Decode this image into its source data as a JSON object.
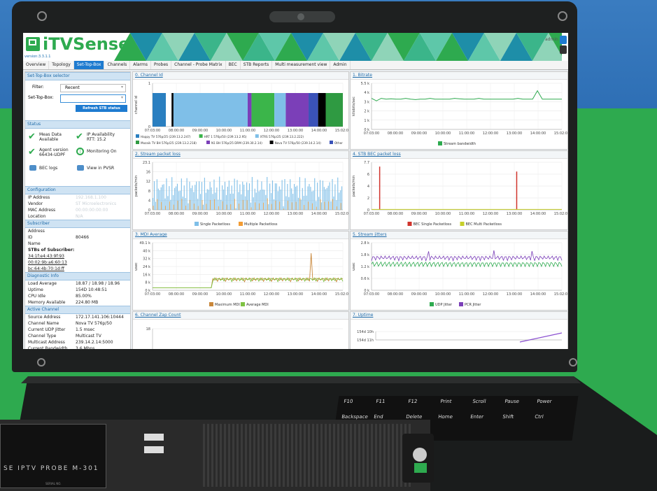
{
  "app": {
    "name": "iTVSense",
    "version": "version:3.3.1.1",
    "user": "admin"
  },
  "tabs": [
    "Overview",
    "Topology",
    "Set-Top-Box",
    "Channels",
    "Alarms",
    "Probes",
    "Channel - Probe Matrix",
    "BEC",
    "STB Reports",
    "Multi measurement view",
    "Admin"
  ],
  "active_tab": "Set-Top-Box",
  "sidebar": {
    "selector_title": "Set-Top-Box selector",
    "filter_label": "Filter:",
    "filter_value": "Recent",
    "stb_label": "Set-Top-Box:",
    "refresh_button": "Refresh STB status",
    "status_title": "Status",
    "status_items": {
      "meas_data": "Meas Data",
      "meas_data_2": "Available",
      "ip_avail": "IP Availability",
      "rtt": "RTT: 15.2",
      "agent": "Agent version",
      "agent_ver": "66434-UDPF",
      "monitoring": "Monitoring On",
      "bec_logs": "BEC logs",
      "view_pvsr": "View in PVSR"
    },
    "config_title": "Configuration",
    "config_rows": [
      {
        "k": "IP Address",
        "v": "192.168.1.100"
      },
      {
        "k": "Vendor",
        "v": "ST Microelectronics"
      },
      {
        "k": "MAC Address",
        "v": "00:00:00:00:00"
      },
      {
        "k": "Location",
        "v": "N/A"
      }
    ],
    "subscriber_title": "Subscriber",
    "subscriber_rows": [
      {
        "k": "Address",
        "v": ""
      },
      {
        "k": "ID",
        "v": "80466"
      },
      {
        "k": "Name",
        "v": ""
      }
    ],
    "stbs_title": "STBs of Subscriber:",
    "stbs": [
      "34:1f:e4:43:9f:93",
      "00:02:9b:a6:60:13",
      "bc:64:4b:70:1d:ff"
    ],
    "diag_title": "Diagnostic Info",
    "diag_rows": [
      {
        "k": "Load Average",
        "v": "18.87 / 18.98 / 18.96"
      },
      {
        "k": "Uptime",
        "v": "154D 10:48:51"
      },
      {
        "k": "CPU Idle",
        "v": "85.00%"
      },
      {
        "k": "Memory Available",
        "v": "224.80 MB"
      }
    ],
    "active_title": "Active Channel",
    "active_rows": [
      {
        "k": "Source Address",
        "v": "172.17.141.106:10444"
      },
      {
        "k": "Channel Name",
        "v": "Nova TV 576p/50"
      },
      {
        "k": "Current UDP Jitter",
        "v": "1.5 msec"
      },
      {
        "k": "Channel Type",
        "v": "Multicast TV"
      },
      {
        "k": "Multicast Address",
        "v": "239.14.2.14:5000"
      },
      {
        "k": "Current Bandwidth",
        "v": "3.6 Mbps"
      }
    ]
  },
  "panels": {
    "p0": "0. Channel Id",
    "p1": "1. Bitrate",
    "p2": "2. Stream packet loss",
    "p3": "3. MDI Average",
    "p4": "4. STB BEC packet loss",
    "p5": "5. Stream jitters",
    "p6": "6. Channel Zap Count",
    "p7": "7. Uptime"
  },
  "x_ticks": [
    "07:03:00",
    "08:00:00",
    "09:00:00",
    "10:00:00",
    "11:00:00",
    "12:00:00",
    "13:00:00",
    "14:00:00",
    "15:02:00"
  ],
  "chart_data": [
    {
      "type": "bar",
      "title": "0. Channel Id",
      "ylabel": "channel id",
      "y_ticks": [
        "0",
        "1"
      ],
      "segments": [
        {
          "series": "Happy TV 576p/25 (239.13.2.247)",
          "start": 0,
          "end": 0.07
        },
        {
          "series": "Nova TV 576p/50 (239.14.2.14)",
          "start": 0.1,
          "end": 0.11
        },
        {
          "series": "XTRS 576p/25 (239.13.2.222)",
          "start": 0.11,
          "end": 0.5
        },
        {
          "series": "N1 BH 576p/25 DRM (239.30.2.14)",
          "start": 0.5,
          "end": 0.52
        },
        {
          "series": "HRT 1 576p/50 (239.13.2.95)",
          "start": 0.52,
          "end": 0.64
        },
        {
          "series": "XTRS 576p/25 (239.13.2.222)",
          "start": 0.64,
          "end": 0.7
        },
        {
          "series": "N1 BH 576p/25 DRM (239.30.2.14)",
          "start": 0.7,
          "end": 0.82
        },
        {
          "series": "Other",
          "start": 0.82,
          "end": 0.87
        },
        {
          "series": "Nova TV 576p/50 (239.14.2.14)",
          "start": 0.87,
          "end": 0.91
        },
        {
          "series": "Mozaik TV BH 576p/25 (239.13.2.218)",
          "start": 0.91,
          "end": 1.0
        }
      ],
      "legend": [
        {
          "name": "Happy TV 576p/25 (239.13.2.247)",
          "color": "#2a7fc0"
        },
        {
          "name": "HRT 1 576p/50 (239.13.2.95)",
          "color": "#3bb54a"
        },
        {
          "name": "XTRS 576p/25 (239.13.2.222)",
          "color": "#7fbfe8"
        },
        {
          "name": "Mozaik TV BH 576p/25 (239.13.2.218)",
          "color": "#2f9a42"
        },
        {
          "name": "N1 BH 576p/25 DRM (239.30.2.14)",
          "color": "#7b3fb8"
        },
        {
          "name": "Nova TV 576p/50 (239.14.2.14)",
          "color": "#000000"
        },
        {
          "name": "Other",
          "color": "#3a52b8"
        }
      ]
    },
    {
      "type": "line",
      "title": "1. Bitrate",
      "ylabel": "kilobits/sec",
      "y_ticks": [
        "0 k",
        "1 k",
        "2 k",
        "3 k",
        "4 k",
        "5.5 k"
      ],
      "series": [
        {
          "name": "Stream bandwidth",
          "color": "#2eaa4f",
          "values": [
            3.7,
            3.4,
            3.7,
            3.6,
            3.65,
            3.6,
            3.6,
            3.7,
            3.6,
            3.55,
            3.6,
            3.6,
            3.7,
            3.6,
            3.6,
            3.6,
            3.6,
            3.7,
            3.65,
            3.6,
            3.6,
            3.6,
            3.7,
            3.6,
            3.6,
            3.6,
            3.6,
            3.6,
            3.6,
            3.6,
            3.7,
            3.6,
            3.6,
            3.6,
            4.6,
            3.6,
            3.6,
            3.6,
            3.6,
            3.6
          ]
        }
      ]
    },
    {
      "type": "bar",
      "title": "2. Stream packet loss",
      "ylabel": "packets/min",
      "y_ticks": [
        "0",
        "4",
        "8",
        "12",
        "16",
        "23.1"
      ],
      "series": [
        {
          "name": "Single Packetloss",
          "color": "#7fbfe8"
        },
        {
          "name": "Multiple Packetloss",
          "color": "#f39c34"
        }
      ]
    },
    {
      "type": "line",
      "title": "3. MDI Average",
      "ylabel": "usec",
      "y_ticks": [
        "0 k",
        "8 k",
        "16 k",
        "24 k",
        "32 k",
        "40 k",
        "49.1 k"
      ],
      "series": [
        {
          "name": "Maximum MDI",
          "color": "#c9873a"
        },
        {
          "name": "Average MDI",
          "color": "#7ec242"
        }
      ]
    },
    {
      "type": "bar",
      "title": "4. STB BEC packet loss",
      "ylabel": "packets/min",
      "y_ticks": [
        "0",
        "2",
        "4",
        "6",
        "7.7"
      ],
      "series": [
        {
          "name": "BEC Single Packetloss",
          "color": "#d0342c",
          "spikes": [
            0.04,
            0.76
          ],
          "values": [
            7.0,
            6.2
          ]
        },
        {
          "name": "BEC Multi Packetloss",
          "color": "#c6cf2a"
        }
      ]
    },
    {
      "type": "line",
      "title": "5. Stream jitters",
      "ylabel": "usec",
      "y_ticks": [
        "0 k",
        "0.6 k",
        "1.2 k",
        "1.8 k",
        "2.8 k"
      ],
      "series": [
        {
          "name": "UDP Jitter",
          "color": "#2eaa4f"
        },
        {
          "name": "PCR Jitter",
          "color": "#7b3fb8"
        }
      ]
    },
    {
      "type": "line",
      "title": "6. Channel Zap Count",
      "y_ticks": [
        "22",
        "18"
      ]
    },
    {
      "type": "line",
      "title": "7. Uptime",
      "y_ticks": [
        "154d 11h",
        "154d 10h"
      ]
    }
  ]
}
